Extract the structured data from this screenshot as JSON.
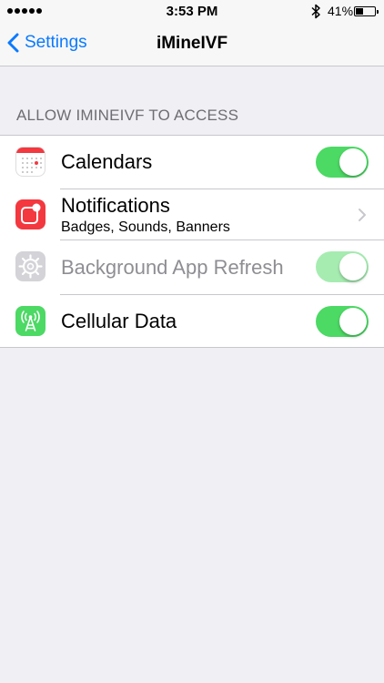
{
  "status_bar": {
    "time": "3:53 PM",
    "battery_percent": "41%",
    "battery_level": 0.41,
    "signal_dots": 5,
    "bluetooth_icon": "bluetooth-icon"
  },
  "nav": {
    "back_label": "Settings",
    "title": "iMineIVF"
  },
  "section": {
    "header": "ALLOW IMINEIVF TO ACCESS"
  },
  "rows": [
    {
      "label": "Calendars",
      "icon": "calendar-icon",
      "toggle_on": true,
      "enabled": true
    },
    {
      "label": "Notifications",
      "subtitle": "Badges, Sounds, Banners",
      "icon": "notifications-icon",
      "accessory": "chevron-right-icon"
    },
    {
      "label": "Background App Refresh",
      "icon": "gear-icon",
      "toggle_on": true,
      "enabled": false
    },
    {
      "label": "Cellular Data",
      "icon": "cellular-antenna-icon",
      "toggle_on": true,
      "enabled": true
    }
  ],
  "colors": {
    "accent": "#0a7aff",
    "toggle_on": "#4cd964",
    "toggle_disabled": "#a6ecb1",
    "notifications_icon_bg": "#f3383f",
    "cellular_icon_bg": "#4cd964",
    "gear_icon_bg": "#d3d3d8",
    "disabled_text": "#8e8e93"
  }
}
